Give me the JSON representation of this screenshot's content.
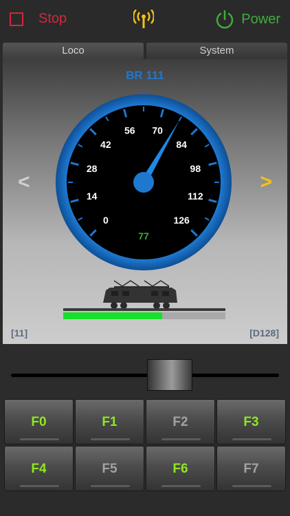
{
  "topbar": {
    "stop_label": "Stop",
    "power_label": "Power",
    "antenna_icon": "antenna-signal-icon",
    "stop_color": "#d8243c",
    "power_color": "#3fae3c",
    "antenna_color": "#f2c216"
  },
  "tabs": [
    {
      "label": "Loco",
      "active": true
    },
    {
      "label": "System",
      "active": false
    }
  ],
  "loco": {
    "name": "BR 111",
    "speed": 77,
    "speed_max": 126,
    "address_left": "[11]",
    "address_right": "[D128]",
    "prev_arrow": "<",
    "next_arrow": ">",
    "progress_fraction": 0.61
  },
  "gauge": {
    "ticks": [
      "0",
      "14",
      "28",
      "42",
      "56",
      "70",
      "84",
      "98",
      "112",
      "126"
    ],
    "accent_color": "#1e78d0",
    "speed_color": "#3fae3c"
  },
  "functions": [
    {
      "label": "F0",
      "on": true
    },
    {
      "label": "F1",
      "on": true
    },
    {
      "label": "F2",
      "on": false
    },
    {
      "label": "F3",
      "on": true
    },
    {
      "label": "F4",
      "on": true
    },
    {
      "label": "F5",
      "on": false
    },
    {
      "label": "F6",
      "on": true
    },
    {
      "label": "F7",
      "on": false
    }
  ],
  "throttle_fraction": 0.61
}
